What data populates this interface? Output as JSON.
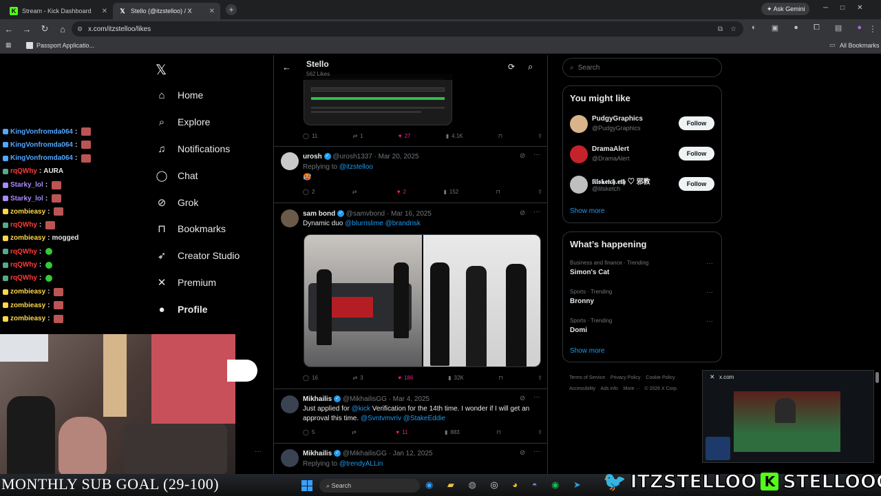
{
  "browser": {
    "tabs": [
      {
        "title": "Stream - Kick Dashboard",
        "icon": "kick-icon"
      },
      {
        "title": "Stello (@itzstelloo) / X",
        "icon": "x-icon"
      }
    ],
    "url": "x.com/itzstelloo/likes",
    "ask_gemini": "Ask Gemini",
    "bookmark_left": "Passport Applicatio...",
    "bookmark_right": "All Bookmarks"
  },
  "nav": {
    "items": [
      {
        "label": "Home",
        "icon": "home-icon",
        "glyph": "⌂"
      },
      {
        "label": "Explore",
        "icon": "search-icon",
        "glyph": "⌕"
      },
      {
        "label": "Notifications",
        "icon": "bell-icon",
        "glyph": "♫"
      },
      {
        "label": "Chat",
        "icon": "chat-icon",
        "glyph": "◯"
      },
      {
        "label": "Grok",
        "icon": "grok-icon",
        "glyph": "⊘"
      },
      {
        "label": "Bookmarks",
        "icon": "bookmark-icon",
        "glyph": "⊓"
      },
      {
        "label": "Creator Studio",
        "icon": "rocket-icon",
        "glyph": "➶"
      },
      {
        "label": "Premium",
        "icon": "x-logo-icon",
        "glyph": "✕"
      },
      {
        "label": "Profile",
        "icon": "person-icon",
        "glyph": "●"
      }
    ]
  },
  "header": {
    "name": "Stello",
    "likes": "562 Likes"
  },
  "tweets": [
    {
      "replies": "11",
      "retweets": "1",
      "likes": "27",
      "views": "4.1K"
    },
    {
      "name": "urosh",
      "handle": "@urosh1337 · Mar 20, 2025",
      "replying": "Replying to ",
      "replying_to": "@itzstelloo",
      "body": "🥵",
      "replies": "2",
      "retweets": "",
      "likes": "2",
      "views": "152"
    },
    {
      "name": "sam bond",
      "handle": "@samvbond · Mar 16, 2025",
      "body": "Dynamic duo ",
      "mention1": "@blurrislime",
      "mention2": "@brandrisk",
      "replies": "16",
      "retweets": "3",
      "likes": "186",
      "views": "32K"
    },
    {
      "name": "Mikhailis",
      "handle": "@MikhailisGG · Mar 4, 2025",
      "body1": "Just applied for ",
      "mention1": "@kick",
      "body2": "  Verification for the 14th time. I wonder if I will get an approval this time. ",
      "mention2": "@Svntvmvriv",
      "mention3": "@StakeEddie",
      "replies": "5",
      "retweets": "",
      "likes": "11",
      "views": "883"
    },
    {
      "name": "Mikhailis",
      "handle": "@MikhailisGG · Jan 12, 2025",
      "replying": "Replying to ",
      "replying_to": "@trendyALLin"
    }
  ],
  "sidebar": {
    "search_placeholder": "Search",
    "might_like_title": "You might like",
    "suggestions": [
      {
        "name": "PudgyGraphics",
        "handle": "@PudgyGraphics",
        "button": "Follow"
      },
      {
        "name": "DramaAlert",
        "handle": "@DramaAlert",
        "button": "Follow"
      },
      {
        "name": "𝖑𝖎𝖑𝖘𝖐𝖊𝖙𝖈𝖍.𝖊𝖙𝖍 ♡ 邪教",
        "handle": "@lilsketch",
        "button": "Follow"
      }
    ],
    "show_more": "Show more",
    "happening_title": "What’s happening",
    "trends": [
      {
        "category": "Business and finance · Trending",
        "title": "Simon's Cat"
      },
      {
        "category": "Sports · Trending",
        "title": "Bronny"
      },
      {
        "category": "Sports · Trending",
        "title": "Domi"
      }
    ],
    "footer": [
      "Terms of Service",
      "Privacy Policy",
      "Cookie Policy",
      "Accessibility",
      "Ads info",
      "More ···",
      "© 2026 X Corp."
    ]
  },
  "chat": [
    {
      "user": "KingVonfromda064",
      "color": "#53a7ff",
      "msg": "",
      "emote": "red"
    },
    {
      "user": "KingVonfromda064",
      "color": "#53a7ff",
      "msg": "",
      "emote": "red"
    },
    {
      "user": "KingVonfromda064",
      "color": "#53a7ff",
      "msg": "",
      "emote": "red"
    },
    {
      "user": "rqQWhy",
      "color": "#ff3b3b",
      "msg": "AURA",
      "emote": ""
    },
    {
      "user": "Starky_lol",
      "color": "#a98bff",
      "msg": "",
      "emote": "red"
    },
    {
      "user": "Starky_lol",
      "color": "#a98bff",
      "msg": "",
      "emote": "red"
    },
    {
      "user": "zombieasy",
      "color": "#ffd84a",
      "msg": "",
      "emote": "red"
    },
    {
      "user": "rqQWhy",
      "color": "#ff3b3b",
      "msg": "",
      "emote": "red"
    },
    {
      "user": "zombieasy",
      "color": "#ffd84a",
      "msg": "mogged",
      "emote": ""
    },
    {
      "user": "rqQWhy",
      "color": "#ff3b3b",
      "msg": "",
      "emote": "green"
    },
    {
      "user": "rqQWhy",
      "color": "#ff3b3b",
      "msg": "",
      "emote": "green"
    },
    {
      "user": "rqQWhy",
      "color": "#ff3b3b",
      "msg": "",
      "emote": "green"
    },
    {
      "user": "zombieasy",
      "color": "#ffd84a",
      "msg": "",
      "emote": "red"
    },
    {
      "user": "zombieasy",
      "color": "#ffd84a",
      "msg": "",
      "emote": "red"
    },
    {
      "user": "zombieasy",
      "color": "#ffd84a",
      "msg": "",
      "emote": "red"
    }
  ],
  "overlay": {
    "sub_goal": "MONTHLY SUB GOAL (29-100)",
    "twitter_name": "ITZSTELLOO",
    "kick_name": "STELLOOO",
    "pip_title": "x.com"
  },
  "taskbar": {
    "search": "Search"
  },
  "colors": {
    "accent": "#1d9bf0",
    "like": "#f91880",
    "kick": "#53fc18"
  }
}
